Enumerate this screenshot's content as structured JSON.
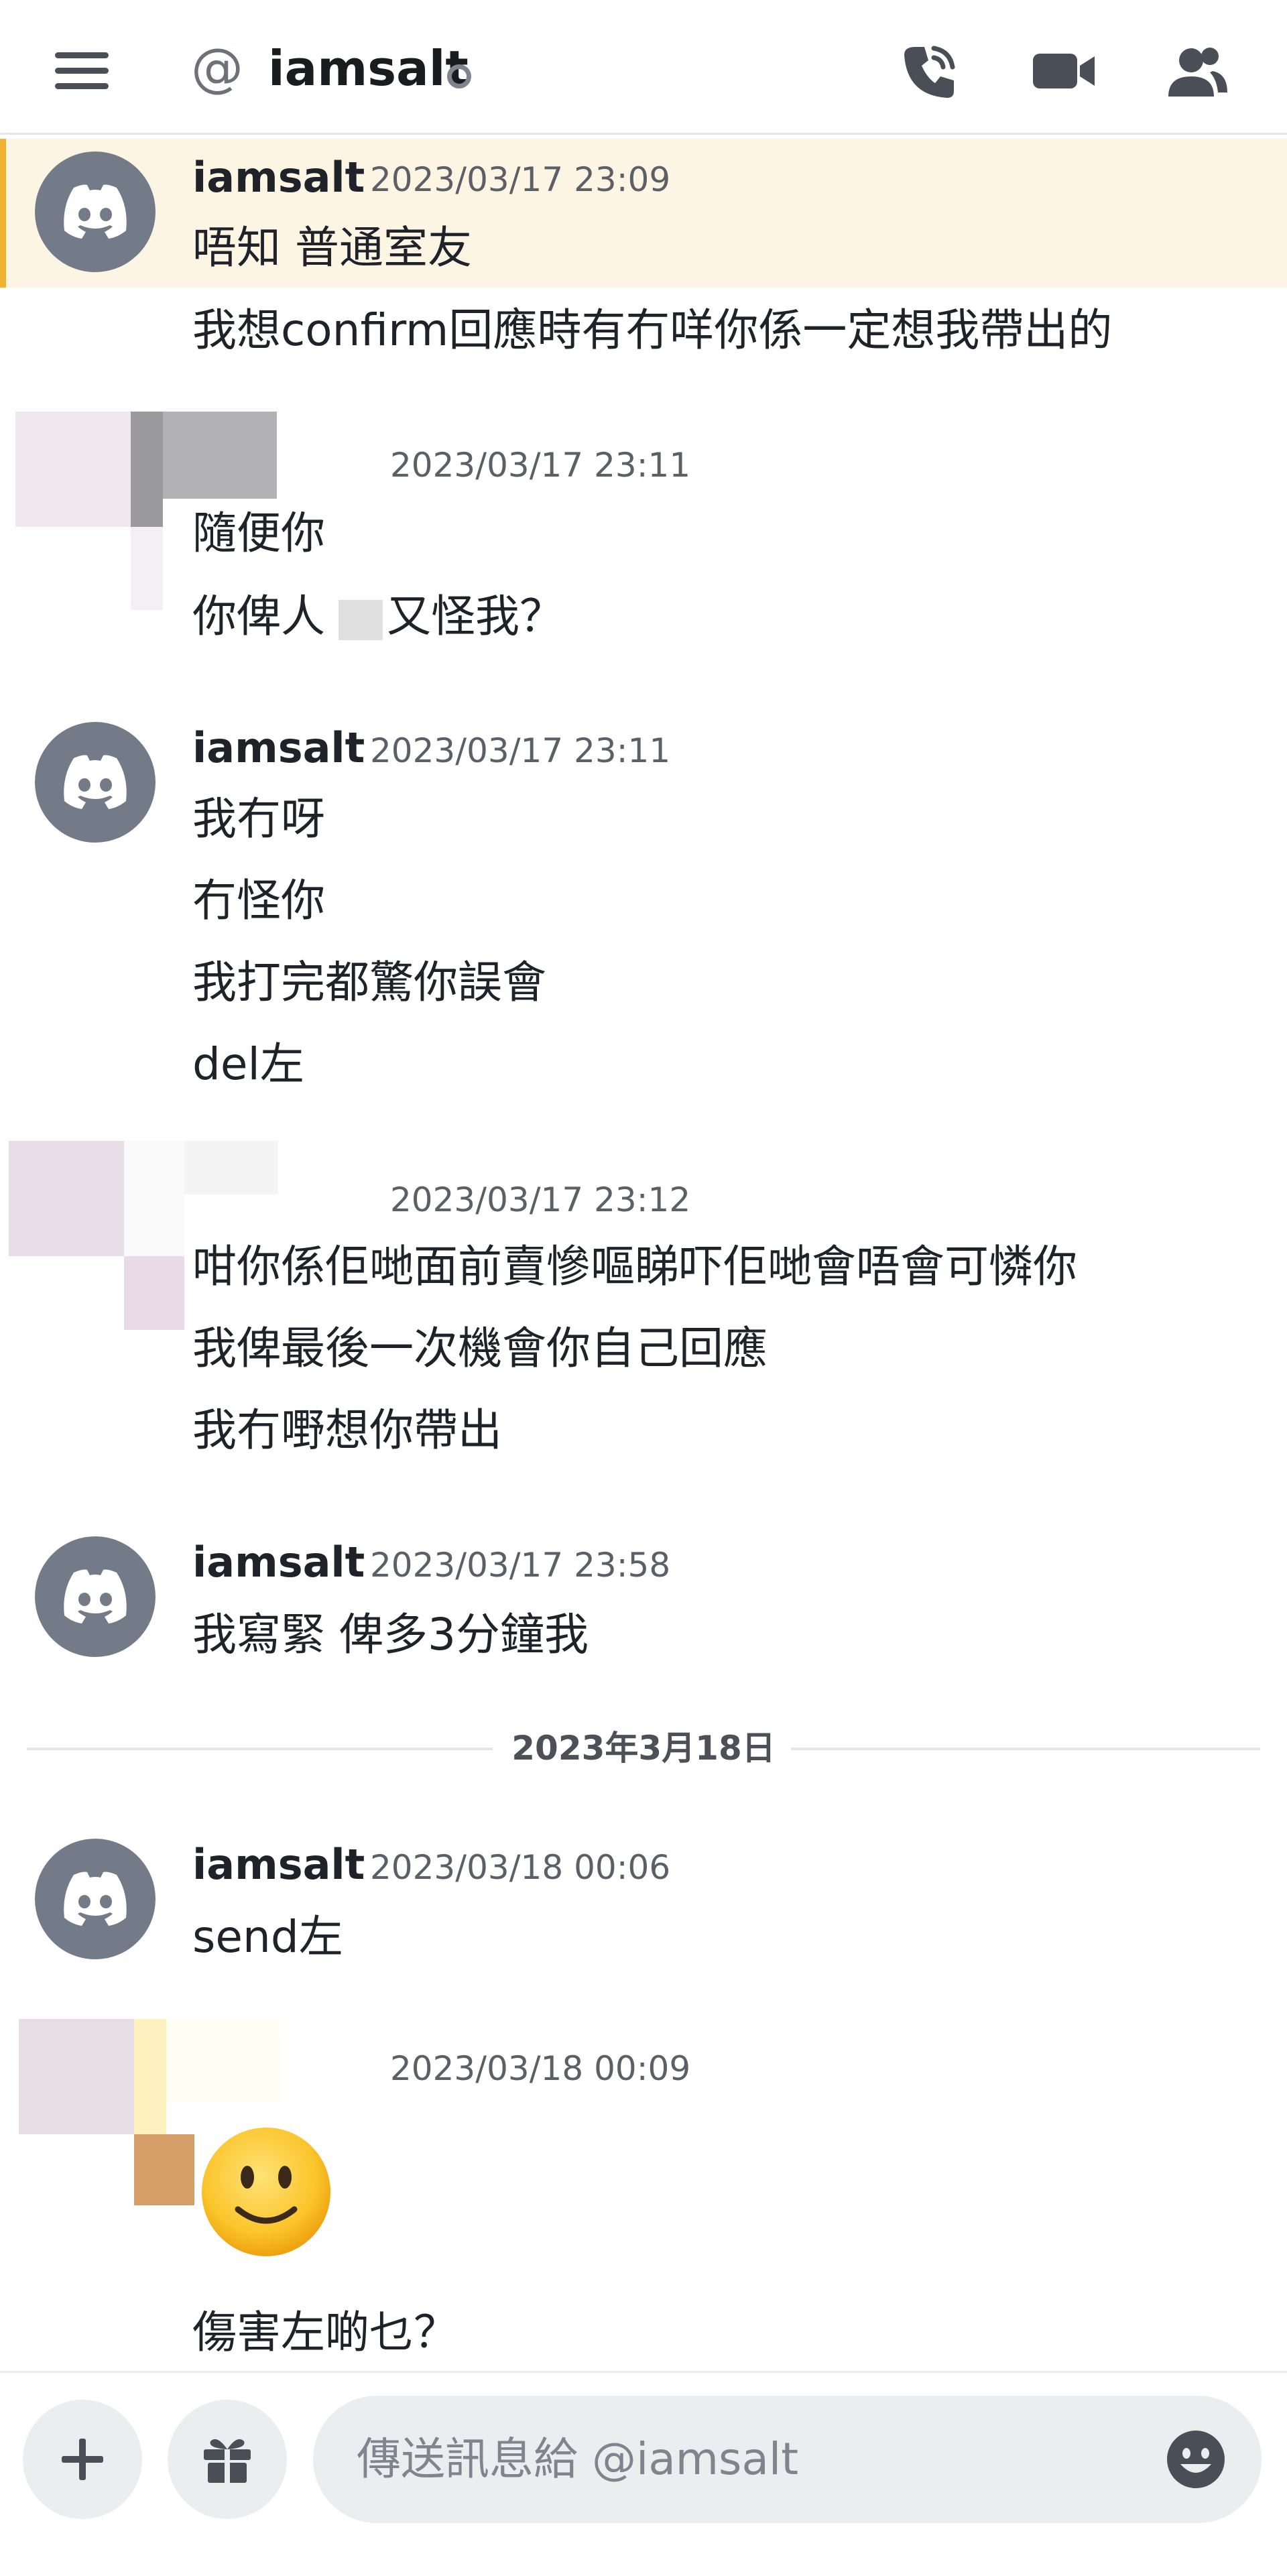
{
  "header": {
    "at_symbol": "@",
    "username": "iamsalt",
    "menu_icon": "hamburger-menu-icon",
    "call_icon": "phone-call-icon",
    "video_icon": "video-camera-icon",
    "members_icon": "member-list-icon"
  },
  "messages": [
    {
      "author": "iamsalt",
      "timestamp": "2023/03/17 23:09",
      "lines": [
        "唔知 普通室友",
        "我想confirm回應時有冇咩你係一定想我帶出的"
      ]
    },
    {
      "author": "",
      "timestamp": "2023/03/17 23:11",
      "lines": [
        "隨便你",
        "你俾人",
        "又怪我？"
      ]
    },
    {
      "author": "iamsalt",
      "timestamp": "2023/03/17 23:11",
      "lines": [
        "我冇呀",
        "冇怪你",
        "我打完都驚你誤會",
        "del左"
      ]
    },
    {
      "author": "",
      "timestamp": "2023/03/17 23:12",
      "lines": [
        "咁你係佢哋面前賣慘嘔睇吓佢哋會唔會可憐你",
        "我俾最後一次機會你自己回應",
        "我冇嘢想你帶出"
      ]
    },
    {
      "author": "iamsalt",
      "timestamp": "2023/03/17 23:58",
      "lines": [
        "我寫緊 俾多3分鐘我"
      ]
    },
    {
      "author": "iamsalt",
      "timestamp": "2023/03/18 00:06",
      "lines": [
        "send左"
      ]
    },
    {
      "author": "",
      "timestamp": "2023/03/18 00:09",
      "lines": [
        "傷害左啲乜？"
      ]
    }
  ],
  "date_divider": "2023年3月18日",
  "emoji": "slightly-smiling-face-emoji",
  "composer": {
    "placeholder": "傳送訊息給 @iamsalt",
    "add_icon": "plus-icon",
    "gift_icon": "gift-icon",
    "emoji_icon": "emoji-picker-icon"
  },
  "colors": {
    "highlight_background": "#fdf5e3",
    "highlight_bar": "#f0b232",
    "avatar_background": "#747b88",
    "input_background": "#ebedef"
  }
}
